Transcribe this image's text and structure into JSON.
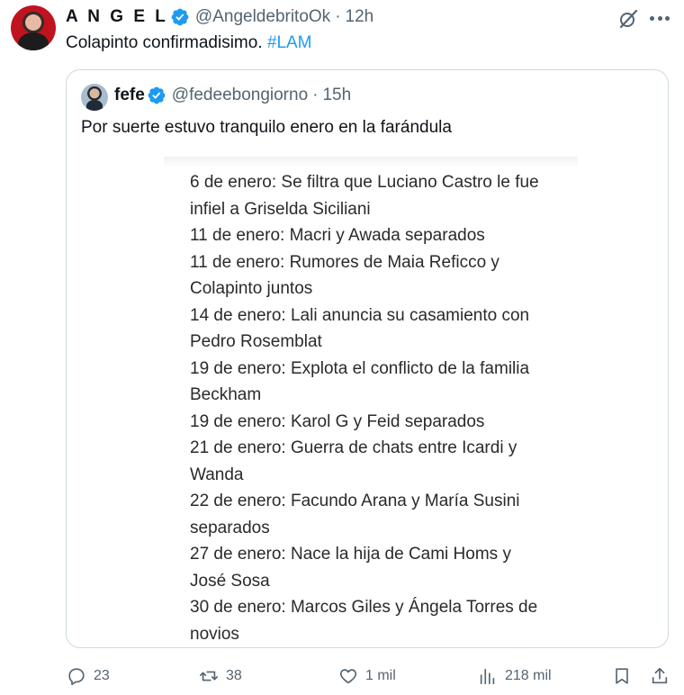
{
  "tweet": {
    "author_name": "A N G E L",
    "handle": "@AngeldebritoOk",
    "separator": "·",
    "time": "12h",
    "text": "Colapinto confirmadisimo.",
    "hashtag": "#LAM"
  },
  "quote": {
    "author_name": "fefe",
    "handle": "@fedeebongiorno",
    "separator": "·",
    "time": "15h",
    "text": "Por suerte estuvo tranquilo enero en la farándula",
    "image_lines": [
      "6 de enero: Se filtra que Luciano Castro le fue",
      "infiel a Griselda Siciliani",
      "11 de enero: Macri y Awada separados",
      "11 de enero: Rumores de Maia Reficco y",
      "Colapinto juntos",
      "14 de enero: Lali anuncia su casamiento con",
      "Pedro Rosemblat",
      "19 de enero: Explota el conflicto de la familia",
      "Beckham",
      "19 de enero: Karol G y Feid separados",
      "21 de enero: Guerra de chats entre Icardi y",
      "Wanda",
      "22 de enero: Facundo Arana y María Susini",
      "separados",
      "27 de enero: Nace la hija de Cami Homs y",
      "José Sosa",
      "30 de enero: Marcos Giles y Ángela Torres de",
      "novios"
    ]
  },
  "actions": {
    "replies": "23",
    "reposts": "38",
    "likes": "1 mil",
    "views": "218 mil"
  },
  "colors": {
    "accent": "#1d9bf0",
    "muted": "#536471",
    "border": "#cfd9de",
    "text": "#0f1419"
  },
  "icons": [
    "verified-badge-icon",
    "grok-icon",
    "more-icon",
    "reply-icon",
    "repost-icon",
    "like-icon",
    "views-icon",
    "bookmark-icon",
    "share-icon"
  ]
}
